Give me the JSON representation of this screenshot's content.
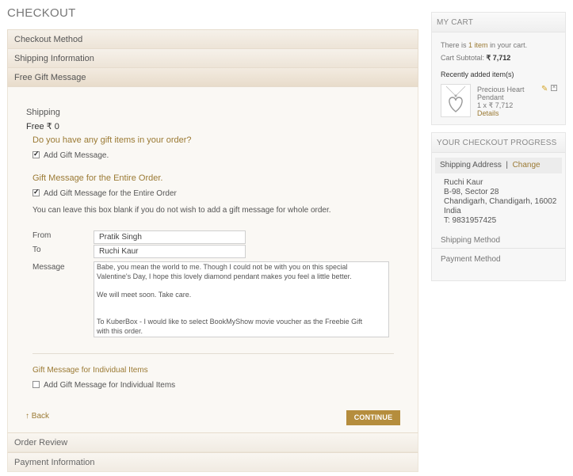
{
  "page_title": "CHECKOUT",
  "steps": {
    "checkout_method": "Checkout Method",
    "shipping_information": "Shipping Information",
    "free_gift_message": "Free Gift Message",
    "order_review": "Order Review",
    "payment_information": "Payment Information"
  },
  "gift": {
    "shipping_label": "Shipping",
    "shipping_value": "Free ₹ 0",
    "question": "Do you have any gift items in your order?",
    "add_gift_message": "Add Gift Message.",
    "entire_order_heading": "Gift Message for the Entire Order.",
    "entire_order_checkbox": "Add Gift Message for the Entire Order",
    "entire_order_hint": "You can leave this box blank if you do not wish to add a gift message for whole order.",
    "from_label": "From",
    "from_value": "Pratik Singh",
    "to_label": "To",
    "to_value": "Ruchi Kaur",
    "message_label": "Message",
    "message_value": "Babe, you mean the world to me. Though I could not be with you on this special\nValentine's Day, I hope this lovely diamond pendant makes you feel a little better.\n\nWe will meet soon. Take care.\n\n\nTo KuberBox - I would like to select BookMyShow movie voucher as the Freebie Gift\nwith this order.",
    "individual_heading": "Gift Message for Individual Items",
    "individual_checkbox": "Add Gift Message for Individual Items",
    "back_label": "Back",
    "continue_label": "CONTINUE"
  },
  "cart": {
    "title": "MY CART",
    "there_is": "There is",
    "item_count": "1 item",
    "in_cart": "in your cart.",
    "subtotal_label": "Cart Subtotal:",
    "subtotal_value": "₹ 7,712",
    "recent_heading": "Recently added item(s)",
    "item_name_1": "Precious Heart",
    "item_name_2": "Pendant",
    "item_qty_price": "1 x ₹ 7,712",
    "details_label": "Details"
  },
  "progress": {
    "title": "YOUR CHECKOUT PROGRESS",
    "shipping_address": "Shipping Address",
    "separator": "|",
    "change_label": "Change",
    "addr_name": "Ruchi Kaur",
    "addr_line1": "B-98, Sector 28",
    "addr_line2": "Chandigarh, Chandigarh, 16002",
    "addr_country": "India",
    "addr_phone": "T: 9831957425",
    "shipping_method": "Shipping Method",
    "payment_method": "Payment Method"
  },
  "colors": {
    "accent": "#b58d3d",
    "gold_text": "#9b7a34"
  }
}
